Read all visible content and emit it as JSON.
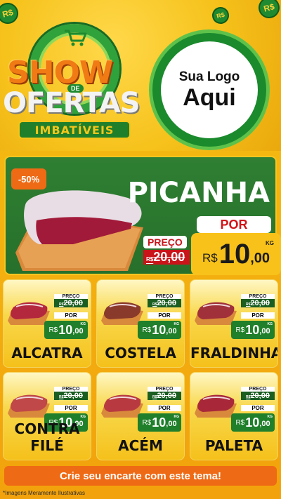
{
  "header": {
    "coin_text": "R$",
    "title_show": "SHOW",
    "title_de": "DE",
    "title_ofertas": "OFERTAS",
    "title_sub": "IMBATÍVEIS",
    "logo_line1": "Sua Logo",
    "logo_line2": "Aqui"
  },
  "featured": {
    "badge": "-50%",
    "name": "PICANHA",
    "por_label": "POR",
    "preco_label": "PREÇO",
    "old_currency": "R$",
    "old_price": "20,00",
    "currency": "R$",
    "price_int": "10",
    "price_dec": ",00",
    "unit": "KG"
  },
  "products": [
    {
      "name": "ALCATRA",
      "preco_label": "PREÇO",
      "old_currency": "R$",
      "old_price": "20,00",
      "por_label": "POR",
      "currency": "R$",
      "price_int": "10",
      "price_dec": ",00",
      "unit": "KG"
    },
    {
      "name": "COSTELA",
      "preco_label": "PREÇO",
      "old_currency": "R$",
      "old_price": "20,00",
      "por_label": "POR",
      "currency": "R$",
      "price_int": "10",
      "price_dec": ",00",
      "unit": "KG"
    },
    {
      "name": "FRALDINHA",
      "preco_label": "PREÇO",
      "old_currency": "R$",
      "old_price": "20,00",
      "por_label": "POR",
      "currency": "R$",
      "price_int": "10",
      "price_dec": ",00",
      "unit": "KG"
    },
    {
      "name": "CONTRA FILÉ",
      "preco_label": "PREÇO",
      "old_currency": "R$",
      "old_price": "20,00",
      "por_label": "POR",
      "currency": "R$",
      "price_int": "10",
      "price_dec": ",00",
      "unit": "KG"
    },
    {
      "name": "ACÉM",
      "preco_label": "PREÇO",
      "old_currency": "R$",
      "old_price": "20,00",
      "por_label": "POR",
      "currency": "R$",
      "price_int": "10",
      "price_dec": ",00",
      "unit": "KG"
    },
    {
      "name": "PALETA",
      "preco_label": "PREÇO",
      "old_currency": "R$",
      "old_price": "20,00",
      "por_label": "POR",
      "currency": "R$",
      "price_int": "10",
      "price_dec": ",00",
      "unit": "KG"
    }
  ],
  "footer": {
    "cta": "Crie seu encarte com este tema!",
    "note": "*Imagens Meramente Ilustrativas"
  },
  "colors": {
    "brand_green": "#1f7f2a",
    "accent_orange": "#ef6a14",
    "background_yellow": "#f8c21a",
    "strike_red": "#c9141a"
  },
  "icons": [
    "shopping-cart-icon",
    "coin-icon",
    "meat-image"
  ]
}
